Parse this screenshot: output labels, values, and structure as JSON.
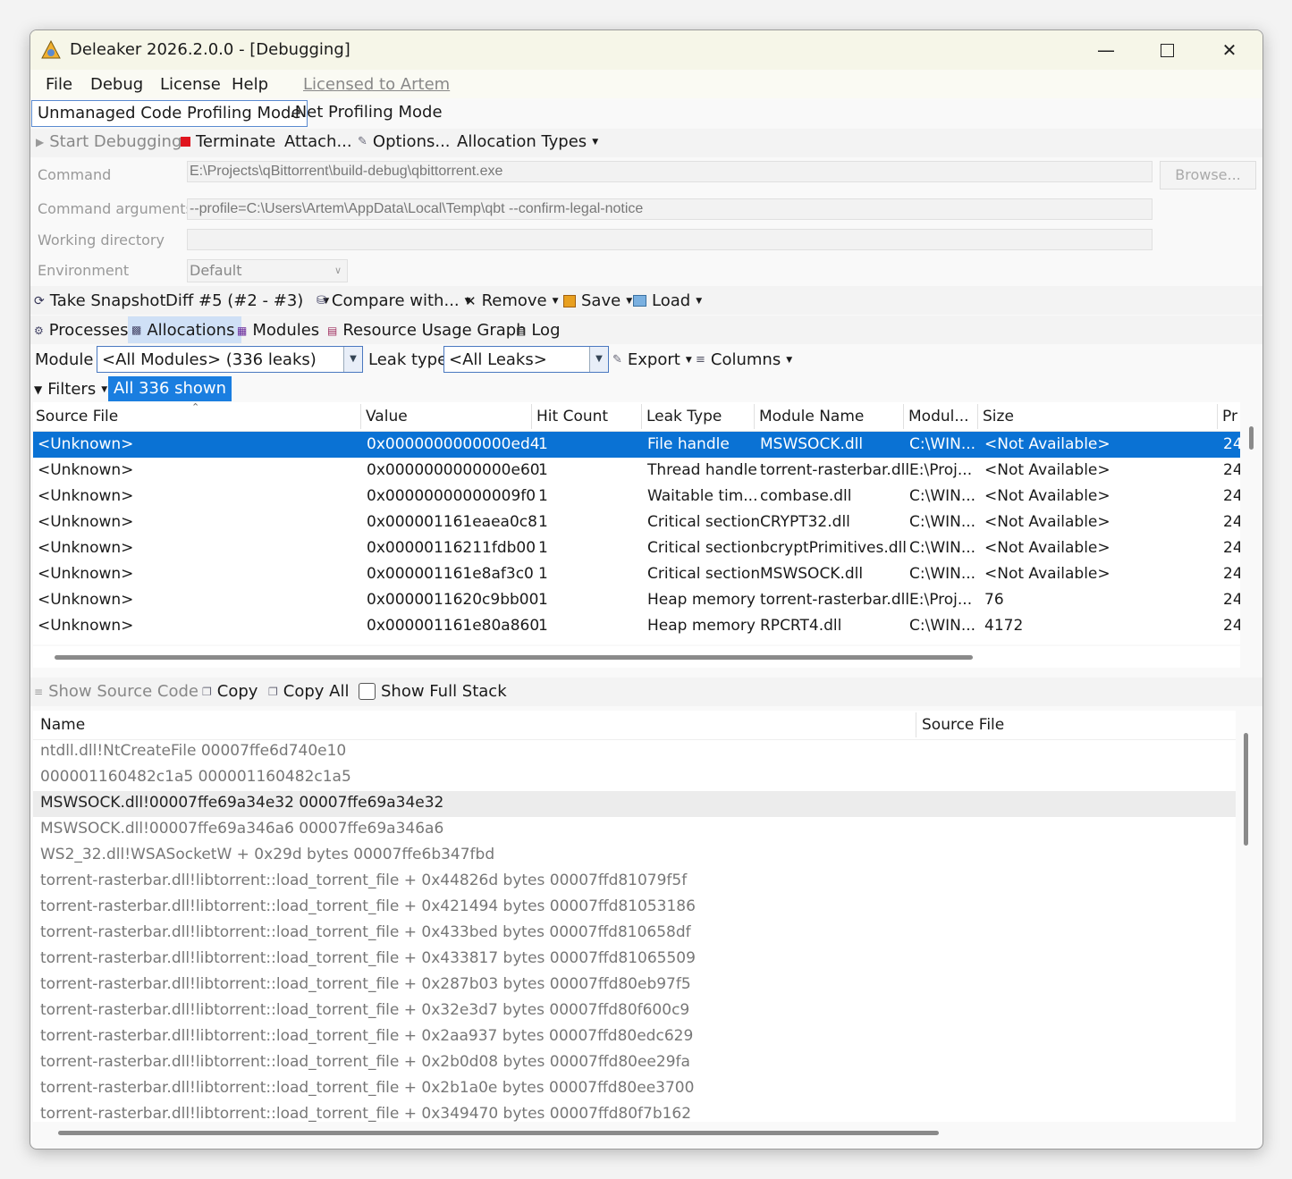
{
  "window": {
    "title": "Deleaker 2026.2.0.0 - [Debugging]"
  },
  "menu": {
    "items": [
      "File",
      "Debug",
      "License",
      "Help"
    ],
    "licensed": "Licensed to Artem"
  },
  "modes": {
    "unmanaged": "Unmanaged Code Profiling Mode",
    "net": ".Net Profiling Mode"
  },
  "toolbar": {
    "start": "Start Debugging",
    "terminate": "Terminate",
    "attach": "Attach...",
    "options": "Options...",
    "alloc_types": "Allocation Types"
  },
  "form": {
    "command_label": "Command",
    "command_value": "E:\\Projects\\qBittorrent\\build-debug\\qbittorrent.exe",
    "args_label": "Command arguments",
    "args_value": "--profile=C:\\Users\\Artem\\AppData\\Local\\Temp\\qbt --confirm-legal-notice",
    "workdir_label": "Working directory",
    "workdir_value": "",
    "env_label": "Environment",
    "env_value": "Default",
    "browse": "Browse..."
  },
  "snapshot_bar": {
    "take": "Take Snapshot",
    "diff": "Diff #5 (#2 - #3)",
    "compare": "Compare with...",
    "remove": "Remove",
    "save": "Save",
    "load": "Load"
  },
  "tabs": {
    "processes": "Processes",
    "allocations": "Allocations",
    "modules": "Modules",
    "resource": "Resource Usage Graph",
    "log": "Log"
  },
  "filter_bar": {
    "module_label": "Module",
    "module_value": "<All Modules> (336 leaks)",
    "leak_label": "Leak type",
    "leak_value": "<All Leaks>",
    "export": "Export",
    "columns": "Columns"
  },
  "filters": {
    "label": "Filters",
    "badge": "All 336 shown"
  },
  "grid": {
    "headers": [
      "Source File",
      "Value",
      "Hit Count",
      "Leak Type",
      "Module Name",
      "Modul...",
      "Size",
      "Pr"
    ],
    "rows": [
      [
        "<Unknown>",
        "0x0000000000000ed4",
        "1",
        "File handle",
        "MSWSOCK.dll",
        "C:\\WIN...",
        "<Not Available>",
        "24"
      ],
      [
        "<Unknown>",
        "0x0000000000000e60",
        "1",
        "Thread handle",
        "torrent-rasterbar.dll",
        "E:\\Proj...",
        "<Not Available>",
        "24"
      ],
      [
        "<Unknown>",
        "0x00000000000009f0",
        "1",
        "Waitable tim...",
        "combase.dll",
        "C:\\WIN...",
        "<Not Available>",
        "24"
      ],
      [
        "<Unknown>",
        "0x000001161eaea0c8",
        "1",
        "Critical section",
        "CRYPT32.dll",
        "C:\\WIN...",
        "<Not Available>",
        "24"
      ],
      [
        "<Unknown>",
        "0x00000116211fdb00",
        "1",
        "Critical section",
        "bcryptPrimitives.dll",
        "C:\\WIN...",
        "<Not Available>",
        "24"
      ],
      [
        "<Unknown>",
        "0x000001161e8af3c0",
        "1",
        "Critical section",
        "MSWSOCK.dll",
        "C:\\WIN...",
        "<Not Available>",
        "24"
      ],
      [
        "<Unknown>",
        "0x0000011620c9bb00",
        "1",
        "Heap memory",
        "torrent-rasterbar.dll",
        "E:\\Proj...",
        "76",
        "24"
      ],
      [
        "<Unknown>",
        "0x000001161e80a860",
        "1",
        "Heap memory",
        "RPCRT4.dll",
        "C:\\WIN...",
        "4172",
        "24"
      ]
    ]
  },
  "stack_toolbar": {
    "show_source": "Show Source Code",
    "copy": "Copy",
    "copy_all": "Copy All",
    "show_full": "Show Full Stack"
  },
  "stack": {
    "headers": [
      "Name",
      "Source File"
    ],
    "rows": [
      "ntdll.dll!NtCreateFile 00007ffe6d740e10",
      "000001160482c1a5 000001160482c1a5",
      "MSWSOCK.dll!00007ffe69a34e32 00007ffe69a34e32",
      "MSWSOCK.dll!00007ffe69a346a6 00007ffe69a346a6",
      "WS2_32.dll!WSASocketW + 0x29d bytes 00007ffe6b347fbd",
      "torrent-rasterbar.dll!libtorrent::load_torrent_file + 0x44826d bytes 00007ffd81079f5f",
      "torrent-rasterbar.dll!libtorrent::load_torrent_file + 0x421494 bytes 00007ffd81053186",
      "torrent-rasterbar.dll!libtorrent::load_torrent_file + 0x433bed bytes 00007ffd810658df",
      "torrent-rasterbar.dll!libtorrent::load_torrent_file + 0x433817 bytes 00007ffd81065509",
      "torrent-rasterbar.dll!libtorrent::load_torrent_file + 0x287b03 bytes 00007ffd80eb97f5",
      "torrent-rasterbar.dll!libtorrent::load_torrent_file + 0x32e3d7 bytes 00007ffd80f600c9",
      "torrent-rasterbar.dll!libtorrent::load_torrent_file + 0x2aa937 bytes 00007ffd80edc629",
      "torrent-rasterbar.dll!libtorrent::load_torrent_file + 0x2b0d08 bytes 00007ffd80ee29fa",
      "torrent-rasterbar.dll!libtorrent::load_torrent_file + 0x2b1a0e bytes 00007ffd80ee3700",
      "torrent-rasterbar.dll!libtorrent::load_torrent_file + 0x349470 bytes 00007ffd80f7b162"
    ]
  },
  "colors": {
    "selection": "#0a72d4",
    "terminate": "#e0141e",
    "accent_border": "#4a78c0"
  }
}
